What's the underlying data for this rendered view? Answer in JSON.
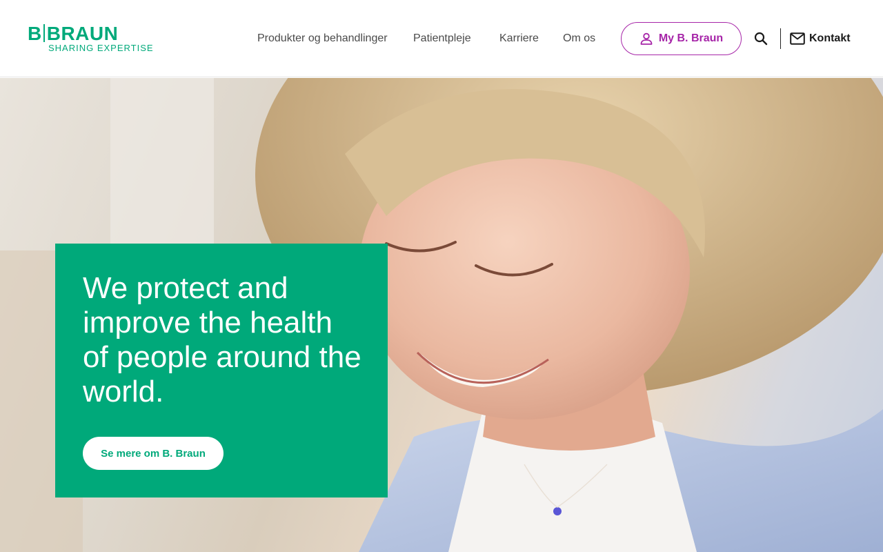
{
  "brand": {
    "logo_main": "B|BRAUN",
    "logo_sub": "SHARING EXPERTISE",
    "color": "#00a97a"
  },
  "nav": {
    "items": [
      {
        "label": "Produkter og behandlinger"
      },
      {
        "label": "Patientpleje"
      },
      {
        "label": "Karriere"
      },
      {
        "label": "Om os"
      }
    ]
  },
  "account": {
    "label": "My B. Braun",
    "color": "#a625a8",
    "icon": "user-icon"
  },
  "search": {
    "icon": "search-icon"
  },
  "contact": {
    "label": "Kontakt",
    "icon": "mail-icon"
  },
  "hero": {
    "image": "smiling-woman-curly-hair-photo",
    "title": "We protect and improve the health of people around the world.",
    "cta_label": "Se mere om B. Braun",
    "panel_color": "#00a97a"
  }
}
